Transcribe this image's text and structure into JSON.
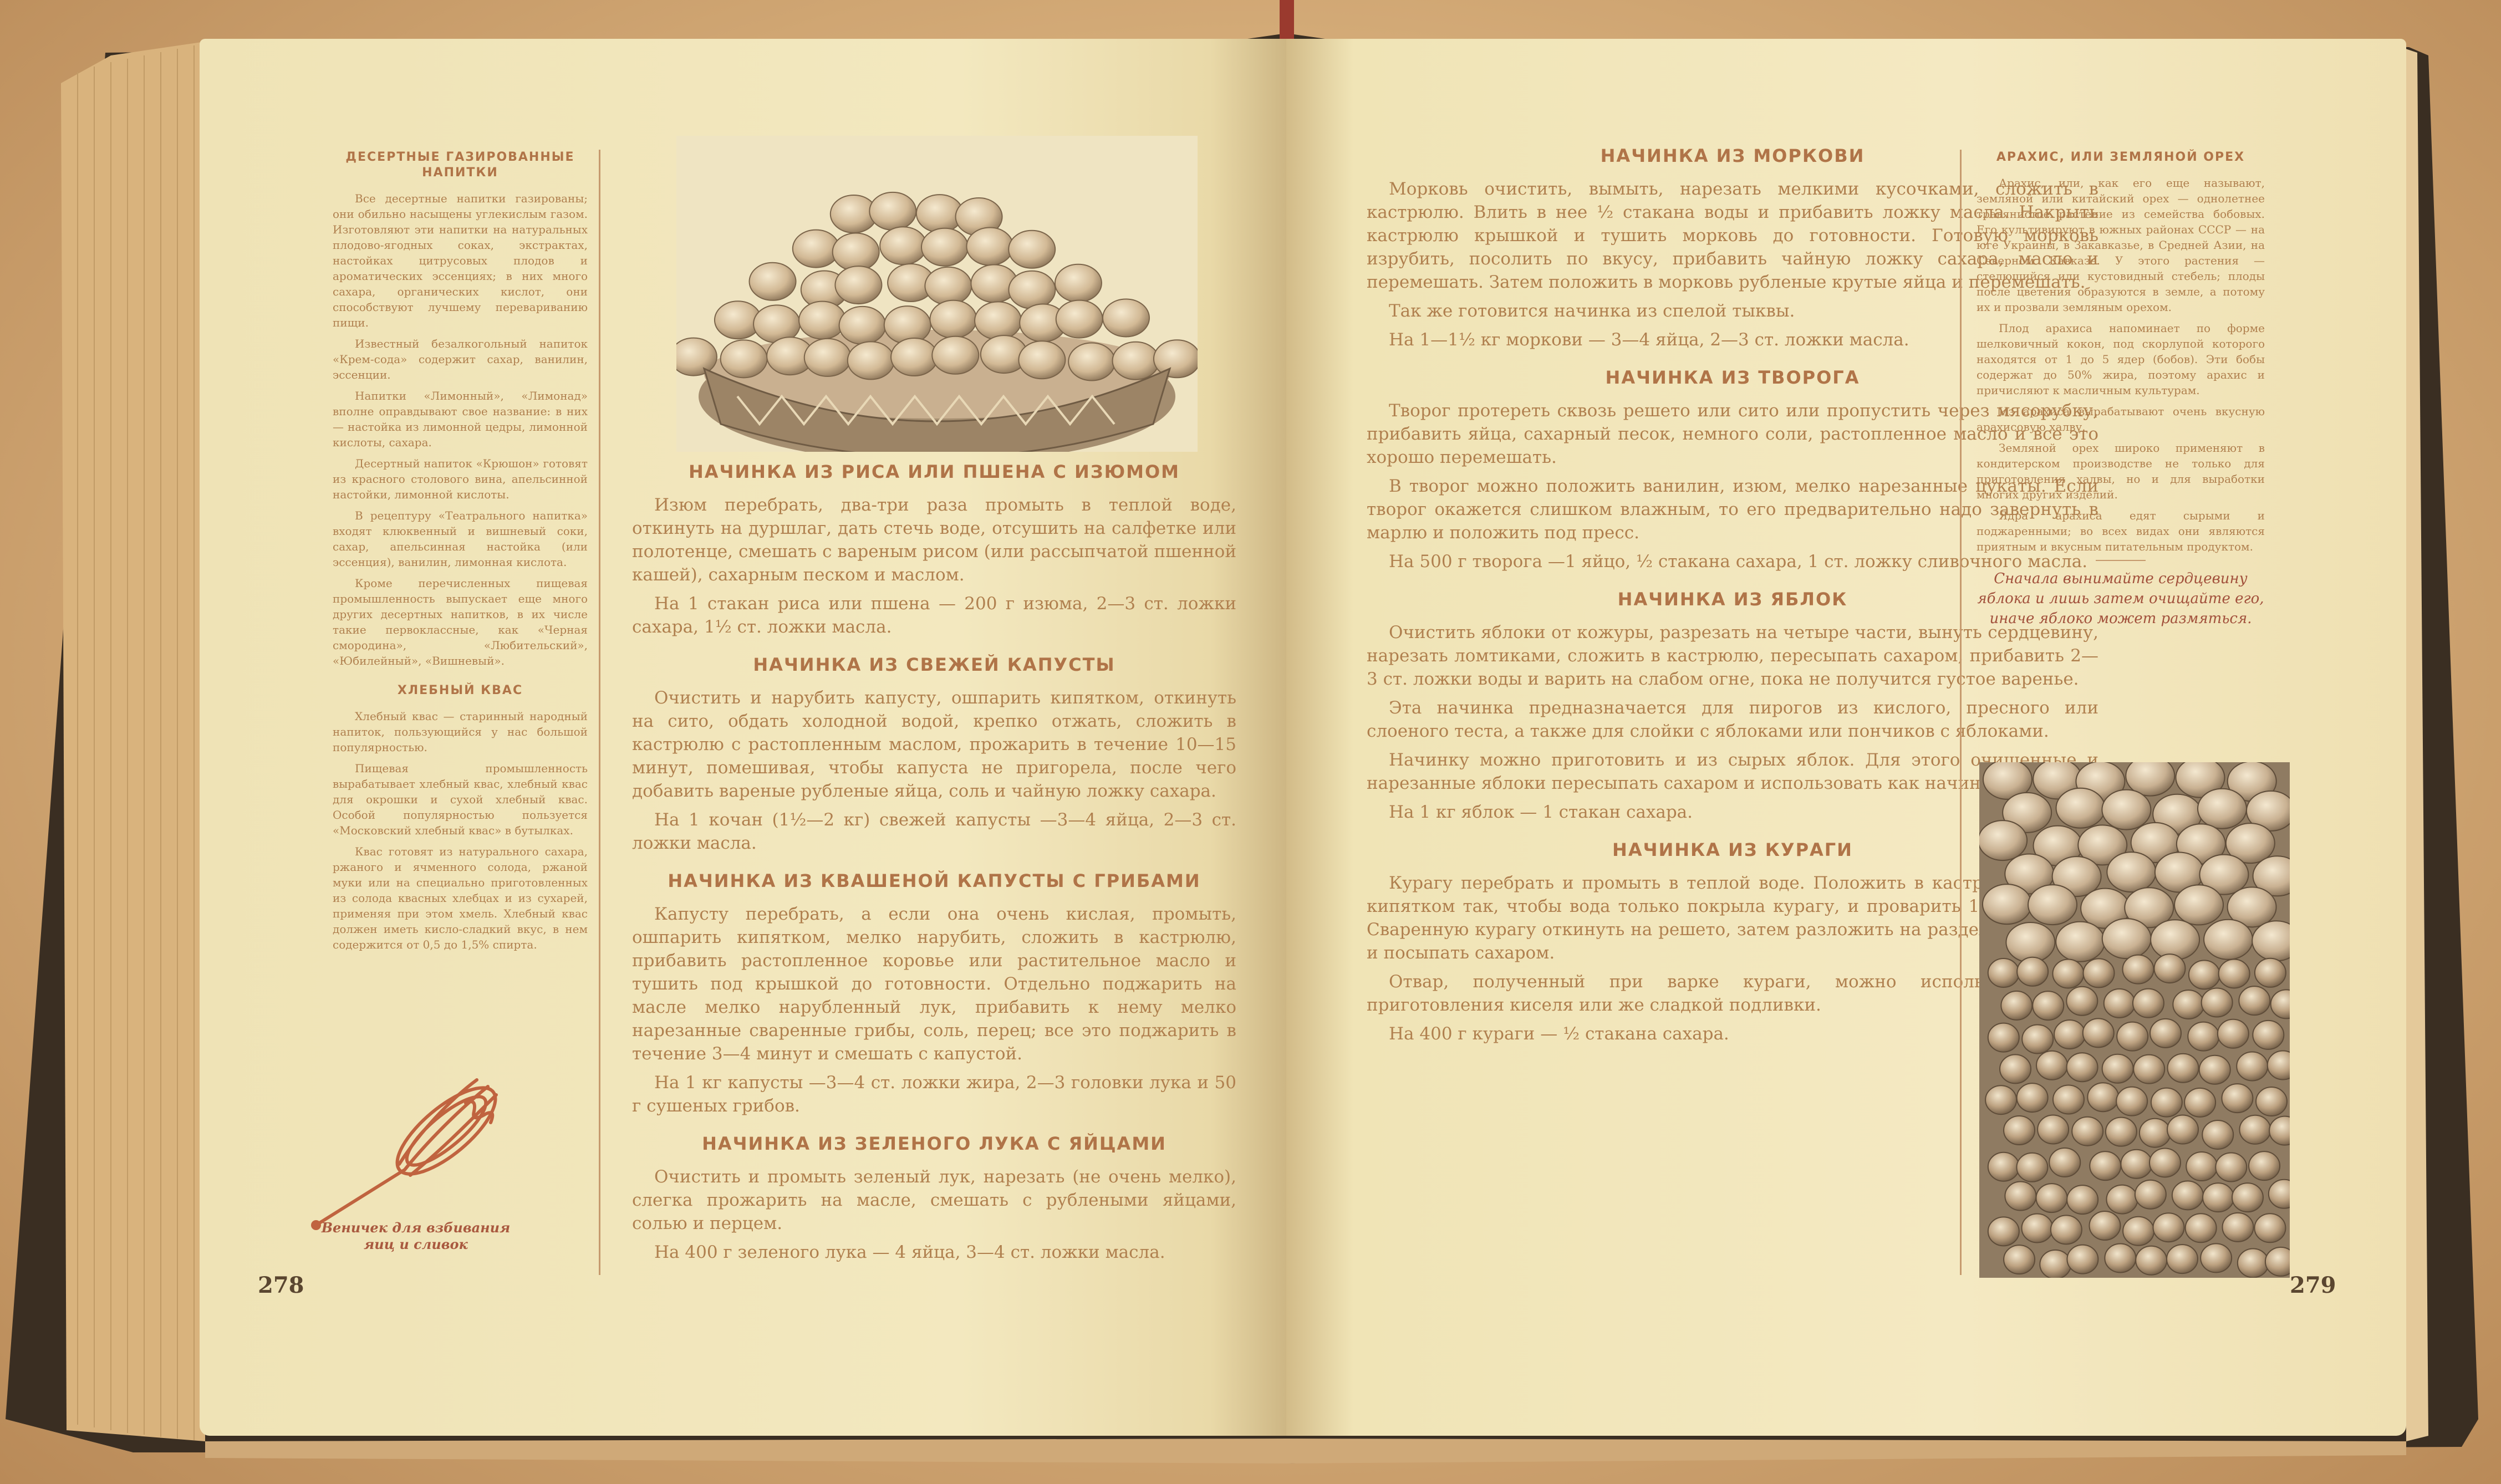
{
  "left_page": {
    "page_number": "278",
    "sidebar": {
      "heading1": "ДЕСЕРТНЫЕ ГАЗИРОВАННЫЕ НАПИТКИ",
      "paragraphs1": [
        "Все десертные напитки газированы; они обильно насыщены углекислым газом. Изготовляют эти напитки на натуральных плодово-ягодных соках, экстрактах, настойках цитрусовых плодов и ароматических эссенциях; в них много сахара, органических кислот, они способствуют лучшему перевариванию пищи.",
        "Известный безалкогольный напиток «Крем-сода» содержит сахар, ванилин, эссенции.",
        "Напитки «Лимонный», «Лимонад» вполне оправдывают свое название: в них — настойка из лимонной цедры, лимонной кислоты, сахара.",
        "Десертный напиток «Крюшон» готовят из красного столового вина, апельсинной настойки, лимонной кислоты.",
        "В рецептуру «Театрального напитка» входят клюквенный и вишневый соки, сахар, апельсинная настойка (или эссенция), ванилин, лимонная кислота.",
        "Кроме перечисленных пищевая промышленность выпускает еще много других десертных напитков, в их числе такие первоклассные, как «Черная смородина», «Любительский», «Юбилейный», «Вишневый»."
      ],
      "heading2": "ХЛЕБНЫЙ КВАС",
      "paragraphs2": [
        "Хлебный квас — старинный народный напиток, пользующийся у нас большой популярностью.",
        "Пищевая промышленность вырабатывает хлебный квас, хлебный квас для окрошки и сухой хлебный квас. Особой популярностью пользуется «Московский хлебный квас» в бутылках.",
        "Квас готовят из натурального сахара, ржаного и ячменного солода, ржаной муки или на специально приготовленных из солода квасных хлебцах и из сухарей, применяя при этом хмель. Хлебный квас должен иметь кисло-сладкий вкус, в нем содержится от 0,5 до 1,5% спирта."
      ],
      "whisk_caption": "Веничек для взбивания яиц и сливок"
    },
    "main": {
      "sections": [
        {
          "heading": "НАЧИНКА ИЗ РИСА ИЛИ ПШЕНА С ИЗЮМОМ",
          "paragraphs": [
            "Изюм перебрать, два-три раза промыть в теплой воде, откинуть на дуршлаг, дать стечь воде, отсушить на салфетке или полотенце, смешать с вареным рисом (или рассыпчатой пшенной кашей), сахарным песком и маслом.",
            "На 1 стакан риса или пшена — 200 г изюма, 2—3 ст. ложки сахара, 1½ ст. ложки масла."
          ]
        },
        {
          "heading": "НАЧИНКА ИЗ СВЕЖЕЙ КАПУСТЫ",
          "paragraphs": [
            "Очистить и нарубить капусту, ошпарить кипятком, откинуть на сито, обдать холодной водой, крепко отжать, сложить в кастрюлю с растопленным маслом, прожарить в течение 10—15 минут, помешивая, чтобы капуста не пригорела, после чего добавить вареные рубленые яйца, соль и чайную ложку сахара.",
            "На 1 кочан (1½—2 кг) свежей капусты —3—4 яйца, 2—3 ст. ложки масла."
          ]
        },
        {
          "heading": "НАЧИНКА ИЗ КВАШЕНОЙ КАПУСТЫ С ГРИБАМИ",
          "paragraphs": [
            "Капусту перебрать, а если она очень кислая, промыть, ошпарить кипятком, мелко нарубить, сложить в кастрюлю, прибавить растопленное коровье или растительное масло и тушить под крышкой до готовности. Отдельно поджарить на масле мелко нарубленный лук, прибавить к нему мелко нарезанные сваренные грибы, соль, перец; все это поджарить в течение 3—4 минут и смешать с капустой.",
            "На 1 кг капусты —3—4 ст. ложки жира, 2—3 головки лука и 50 г сушеных грибов."
          ]
        },
        {
          "heading": "НАЧИНКА ИЗ ЗЕЛЕНОГО ЛУКА С ЯЙЦАМИ",
          "paragraphs": [
            "Очистить и промыть зеленый лук, нарезать (не очень мелко), слегка прожарить на масле, смешать с рублеными яйцами, солью и перцем.",
            "На 400 г зеленого лука — 4 яйца, 3—4 ст. ложки масла."
          ]
        }
      ]
    }
  },
  "right_page": {
    "page_number": "279",
    "main": {
      "sections": [
        {
          "heading": "НАЧИНКА ИЗ МОРКОВИ",
          "paragraphs": [
            "Морковь очистить, вымыть, нарезать мелкими кусочками, сложить в кастрюлю. Влить в нее ½ стакана воды и прибавить ложку масла. Накрыть кастрюлю крышкой и тушить морковь до готовности. Готовую морковь изрубить, посолить по вкусу, прибавить чайную ложку сахара, масло и перемешать. Затем положить в морковь рубленые крутые яйца и перемешать.",
            "Так же готовится начинка из спелой тыквы.",
            "На 1—1½ кг моркови — 3—4 яйца, 2—3 ст. ложки масла."
          ]
        },
        {
          "heading": "НАЧИНКА ИЗ ТВОРОГА",
          "paragraphs": [
            "Творог протереть сквозь решето или сито или пропустить через мясорубку, прибавить яйца, сахарный песок, немного соли, растопленное масло и все это хорошо перемешать.",
            "В творог можно положить ванилин, изюм, мелко нарезанные цукаты. Если творог окажется слишком влажным, то его предварительно надо завернуть в марлю и положить под пресс.",
            "На 500 г творога —1 яйцо, ½ стакана сахара, 1 ст. ложку сливочного масла."
          ]
        },
        {
          "heading": "НАЧИНКА ИЗ ЯБЛОК",
          "paragraphs": [
            "Очистить яблоки от кожуры, разрезать на четыре части, вынуть сердцевину, нарезать ломтиками, сложить в кастрюлю, пересыпать сахаром, прибавить 2—3 ст. ложки воды и варить на слабом огне, пока не получится густое варенье.",
            "Эта начинка предназначается для пирогов из кислого, пресного или слоеного теста, а также для слойки с яблоками или пончиков с яблоками.",
            "Начинку можно приготовить и из сырых яблок. Для этого очищенные и нарезанные яблоки пересыпать сахаром и использовать как начинку.",
            "На 1 кг яблок — 1 стакан сахара."
          ]
        },
        {
          "heading": "НАЧИНКА ИЗ КУРАГИ",
          "paragraphs": [
            "Курагу перебрать и промыть в теплой воде. Положить в кастрюлю, залить кипятком так, чтобы вода только покрыла курагу, и проварить 10—15 минут. Сваренную курагу откинуть на решето, затем разложить на разделанное тесто и посыпать сахаром.",
            "Отвар, полученный при варке кураги, можно использовать для приготовления киселя или же сладкой подливки.",
            "На 400 г кураги — ½ стакана сахара."
          ]
        }
      ]
    },
    "sidebar": {
      "heading": "АРАХИС, ИЛИ ЗЕМЛЯНОЙ ОРЕХ",
      "paragraphs": [
        "Арахис, или, как его еще называют, земляной или китайский орех — однолетнее травянистое растение из семейства бобовых. Его культивируют в южных районах СССР — на юге Украины, в Закавказье, в Средней Азии, на Северном Кавказе. У этого растения — стелющийся или кустовидный стебель; плоды после цветения образуются в земле, а потому их и прозвали земляным орехом.",
        "Плод арахиса напоминает по форме шелковичный кокон, под скорлупой которого находятся от 1 до 5 ядер (бобов). Эти бобы содержат до 50% жира, поэтому арахис и причисляют к масличным культурам.",
        "Из арахиса вырабатывают очень вкусную арахисовую халву.",
        "Земляной орех широко применяют в кондитерском производстве не только для приготовления халвы, но и для выработки многих других изделий.",
        "Ядра арахиса едят сырыми и поджаренными; во всех видах они являются приятным и вкусным питательным продуктом."
      ],
      "tip": "Сначала вынимайте сердцевину яблока и лишь затем очищайте его, иначе яблоко может размяться."
    }
  },
  "colors": {
    "paper": "#f3e8bf",
    "text": "#b0804f",
    "heading": "#b07448",
    "caption": "#a9593f",
    "cover": "#3a2e22",
    "background": "#d3aa77"
  }
}
